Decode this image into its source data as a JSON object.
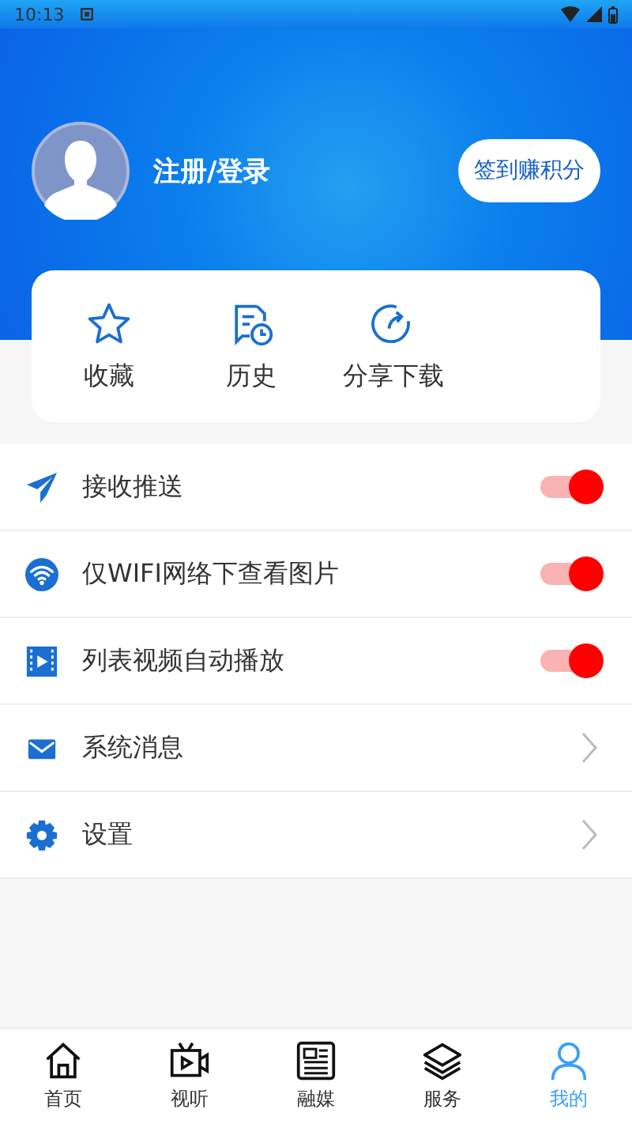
{
  "status_bar": {
    "time": "10:13"
  },
  "profile": {
    "login": "注册/登录",
    "checkin_button": "签到赚积分"
  },
  "shortcuts": [
    {
      "kind": "star",
      "label": "收藏"
    },
    {
      "kind": "history",
      "label": "历史"
    },
    {
      "kind": "share",
      "label": "分享下载"
    }
  ],
  "settings": [
    {
      "kind": "toggle",
      "label": "接收推送",
      "on": true
    },
    {
      "kind": "toggle",
      "label": "仅WIFI网络下查看图片",
      "on": true
    },
    {
      "kind": "toggle",
      "label": "列表视频自动播放",
      "on": true
    },
    {
      "kind": "link",
      "label": "系统消息"
    },
    {
      "kind": "link",
      "label": "设置"
    }
  ],
  "bottom_nav": [
    {
      "label": "首页",
      "selected": false
    },
    {
      "label": "视听",
      "selected": false
    },
    {
      "label": "融媒",
      "selected": false
    },
    {
      "label": "服务",
      "selected": false
    },
    {
      "label": "我的",
      "selected": true
    }
  ]
}
